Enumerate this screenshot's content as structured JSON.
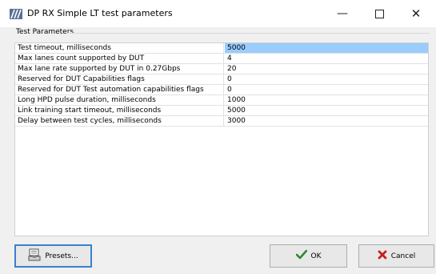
{
  "window": {
    "title": "DP RX Simple LT test parameters",
    "app_icon": "stripes-logo-icon",
    "controls": {
      "minimize": "minimize-icon",
      "maximize": "maximize-icon",
      "close": "close-icon"
    }
  },
  "group": {
    "label": "Test Parameters"
  },
  "parameters": [
    {
      "name": "Test timeout, milliseconds",
      "value": "5000"
    },
    {
      "name": "Max lanes count supported by DUT",
      "value": "4"
    },
    {
      "name": "Max lane rate supported by DUT in 0.27Gbps",
      "value": "20"
    },
    {
      "name": "Reserved for DUT Capabilities flags",
      "value": "0"
    },
    {
      "name": "Reserved for DUT Test automation capabilities flags",
      "value": "0"
    },
    {
      "name": "Long HPD pulse duration, milliseconds",
      "value": "1000"
    },
    {
      "name": "Link training start timeout, milliseconds",
      "value": "5000"
    },
    {
      "name": "Delay between test cycles, milliseconds",
      "value": "3000"
    }
  ],
  "selected_row": 0,
  "buttons": {
    "presets": {
      "label": "Presets...",
      "icon": "presets-icon"
    },
    "ok": {
      "label": "OK",
      "icon": "checkmark-icon"
    },
    "cancel": {
      "label": "Cancel",
      "icon": "x-mark-icon"
    }
  },
  "colors": {
    "selection": "#99ccff",
    "ok_check": "#2e8b2e",
    "cancel_x": "#c81e1e",
    "focus_border": "#3c7fd0"
  }
}
